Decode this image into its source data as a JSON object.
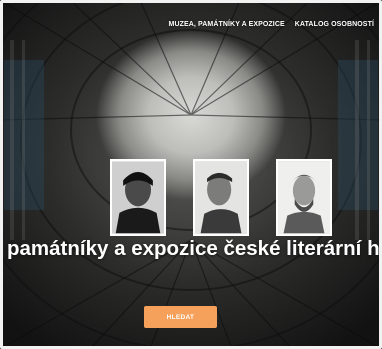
{
  "nav": {
    "items": [
      {
        "label": "MUZEA, PAMÁTNÍKY A EXPOZICE"
      },
      {
        "label": "KATALOG OSOBNOSTÍ"
      }
    ]
  },
  "hero": {
    "headline": "památníky a expozice české literární historie",
    "cta_label": "HLEDAT",
    "cta_color": "#f5a15b"
  },
  "portraits": [
    {
      "icon": "author-portrait-1"
    },
    {
      "icon": "author-portrait-2"
    },
    {
      "icon": "author-portrait-3"
    }
  ]
}
